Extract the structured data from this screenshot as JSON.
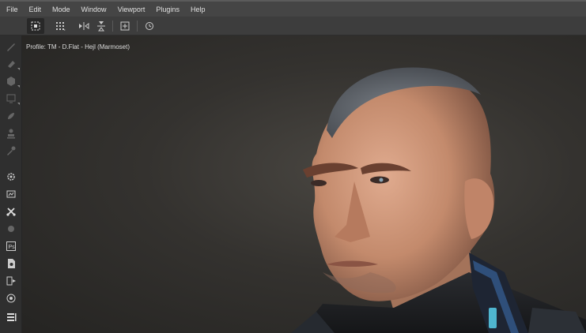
{
  "menu": {
    "items": [
      "File",
      "Edit",
      "Mode",
      "Window",
      "Viewport",
      "Plugins",
      "Help"
    ]
  },
  "toolbar": {
    "buttons": [
      "marquee-select-icon",
      "grid-select-icon",
      "mirror-horizontal-icon",
      "mirror-vertical-icon",
      "frame-icon",
      "history-icon"
    ],
    "active": "marquee-select-icon"
  },
  "left_tools": [
    "brush-icon",
    "eraser-icon",
    "fill-icon",
    "projection-icon",
    "smudge-icon",
    "stamp-icon",
    "eyedropper-icon",
    "settings-icon",
    "image-icon",
    "scissors-icon",
    "material-icon",
    "photoshop-icon",
    "document-icon",
    "export-icon",
    "camera-icon",
    "layers-icon"
  ],
  "viewport": {
    "profile_label": "Profile: TM - D.Flat - Hejl (Marmoset)"
  },
  "colors": {
    "menubar": "#454545",
    "toolbar": "#3d3d3d",
    "panel": "#2f2f2f",
    "viewport_bg": "#34322f"
  }
}
